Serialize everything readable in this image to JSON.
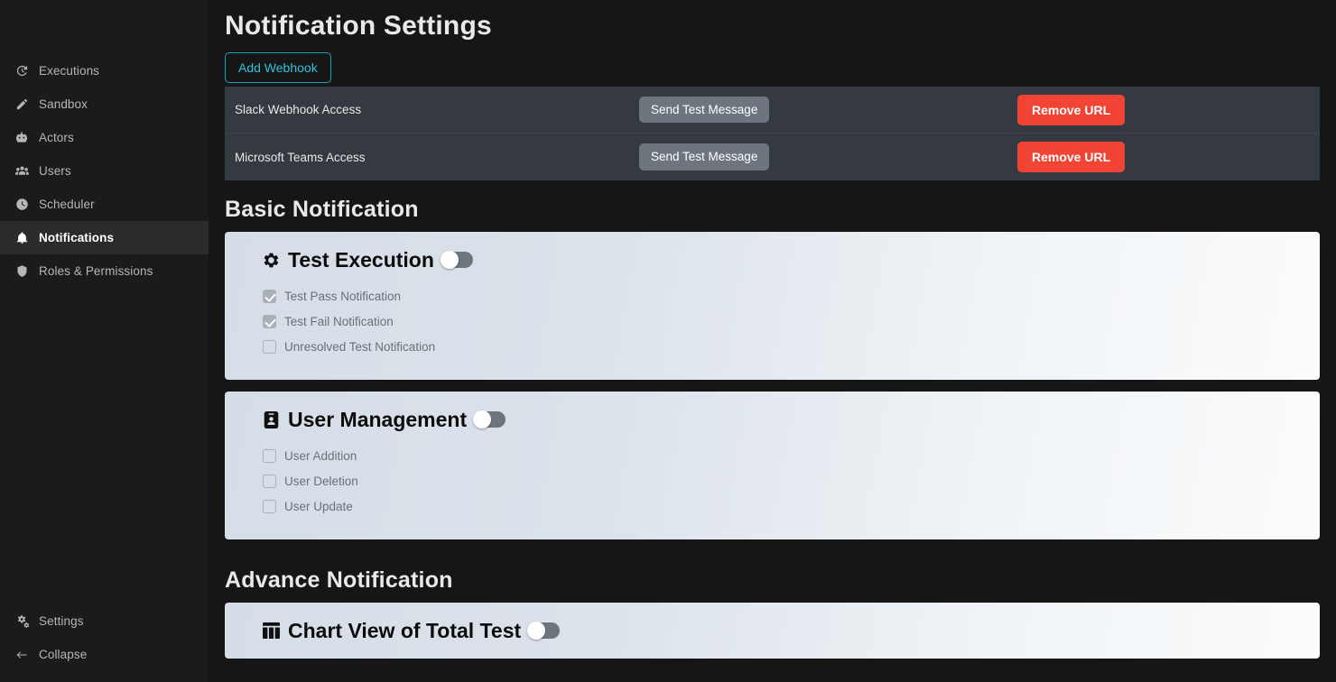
{
  "sidebar": {
    "items": [
      {
        "label": "Executions",
        "icon": "history-icon",
        "active": false
      },
      {
        "label": "Sandbox",
        "icon": "pencil-icon",
        "active": false
      },
      {
        "label": "Actors",
        "icon": "robot-icon",
        "active": false
      },
      {
        "label": "Users",
        "icon": "users-icon",
        "active": false
      },
      {
        "label": "Scheduler",
        "icon": "clock-icon",
        "active": false
      },
      {
        "label": "Notifications",
        "icon": "bell-icon",
        "active": true
      },
      {
        "label": "Roles & Permissions",
        "icon": "shield-icon",
        "active": false
      }
    ],
    "bottom_items": [
      {
        "label": "Settings",
        "icon": "gears-icon"
      },
      {
        "label": "Collapse",
        "icon": "arrow-left-icon"
      }
    ]
  },
  "page": {
    "title": "Notification Settings",
    "add_webhook_label": "Add Webhook"
  },
  "webhooks": {
    "rows": [
      {
        "name": "Slack Webhook Access",
        "send_label": "Send Test Message",
        "remove_label": "Remove URL"
      },
      {
        "name": "Microsoft Teams Access",
        "send_label": "Send Test Message",
        "remove_label": "Remove URL"
      }
    ]
  },
  "basic": {
    "heading": "Basic Notification",
    "cards": [
      {
        "title": "Test Execution",
        "icon": "gear-icon",
        "toggle_on": false,
        "options": [
          {
            "label": "Test Pass Notification",
            "checked": true
          },
          {
            "label": "Test Fail Notification",
            "checked": true
          },
          {
            "label": "Unresolved Test Notification",
            "checked": false
          }
        ]
      },
      {
        "title": "User Management",
        "icon": "id-badge-icon",
        "toggle_on": false,
        "options": [
          {
            "label": "User Addition",
            "checked": false
          },
          {
            "label": "User Deletion",
            "checked": false
          },
          {
            "label": "User Update",
            "checked": false
          }
        ]
      }
    ]
  },
  "advance": {
    "heading": "Advance Notification",
    "cards": [
      {
        "title": "Chart View of Total Test",
        "icon": "table-columns-icon",
        "toggle_on": false,
        "options": []
      }
    ]
  },
  "colors": {
    "accent_cyan": "#17a2b8",
    "danger_red": "#f24434",
    "secondary_gray": "#6d767e",
    "sidebar_bg": "#1b1b1b",
    "page_bg": "#161616",
    "table_bg": "#343a40"
  }
}
